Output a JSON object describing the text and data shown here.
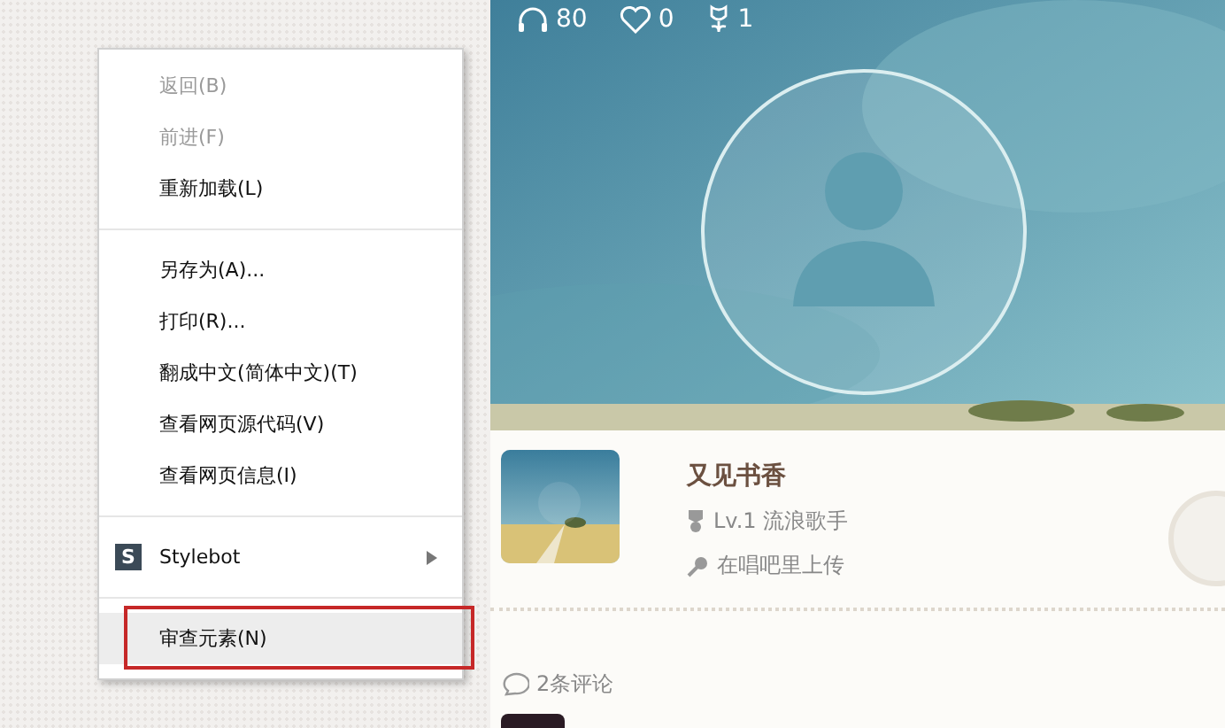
{
  "context_menu": {
    "groups": [
      {
        "items": [
          {
            "label": "返回(B)",
            "disabled": true,
            "selected": false,
            "submenu": false,
            "annotated": false
          },
          {
            "label": "前进(F)",
            "disabled": true,
            "selected": false,
            "submenu": false,
            "annotated": false
          },
          {
            "label": "重新加载(L)",
            "disabled": false,
            "selected": false,
            "submenu": false,
            "annotated": false
          }
        ]
      },
      {
        "items": [
          {
            "label": "另存为(A)...",
            "disabled": false,
            "selected": false,
            "submenu": false,
            "annotated": false
          },
          {
            "label": "打印(R)...",
            "disabled": false,
            "selected": false,
            "submenu": false,
            "annotated": false
          },
          {
            "label": "翻成中文(简体中文)(T)",
            "disabled": false,
            "selected": false,
            "submenu": false,
            "annotated": false
          },
          {
            "label": "查看网页源代码(V)",
            "disabled": false,
            "selected": false,
            "submenu": false,
            "annotated": false
          },
          {
            "label": "查看网页信息(I)",
            "disabled": false,
            "selected": false,
            "submenu": false,
            "annotated": false
          }
        ]
      },
      {
        "items": [
          {
            "label": "Stylebot",
            "icon_letter": "S",
            "disabled": false,
            "selected": false,
            "submenu": true,
            "annotated": false
          }
        ]
      },
      {
        "items": [
          {
            "label": "审查元素(N)",
            "disabled": false,
            "selected": true,
            "submenu": false,
            "annotated": true
          }
        ]
      }
    ]
  },
  "stats": {
    "listens": "80",
    "likes": "0",
    "flowers": "1"
  },
  "profile": {
    "name": "又见书香",
    "level": "Lv.1 流浪歌手",
    "activity": "在唱吧里上传"
  },
  "comments": {
    "count": "2条评论"
  }
}
